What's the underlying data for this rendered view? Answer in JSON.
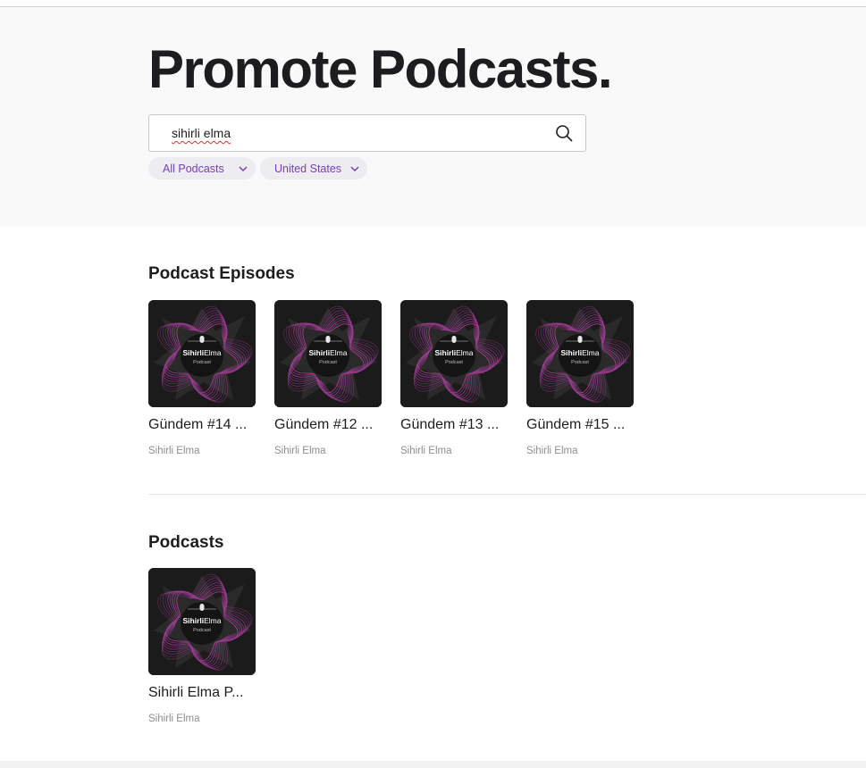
{
  "page": {
    "title": "Promote Podcasts."
  },
  "search": {
    "value": "sihirli elma"
  },
  "filters": [
    {
      "label": "All Podcasts"
    },
    {
      "label": "United States"
    }
  ],
  "episodes_section": {
    "title": "Podcast Episodes",
    "items": [
      {
        "title": "Gündem #14 ...",
        "subtitle": "Sihirli Elma"
      },
      {
        "title": "Gündem #12 ...",
        "subtitle": "Sihirli Elma"
      },
      {
        "title": "Gündem #13 ...",
        "subtitle": "Sihirli Elma"
      },
      {
        "title": "Gündem #15 ...",
        "subtitle": "Sihirli Elma"
      }
    ]
  },
  "podcasts_section": {
    "title": "Podcasts",
    "items": [
      {
        "title": "Sihirli Elma P...",
        "subtitle": "Sihirli Elma"
      }
    ]
  },
  "artwork": {
    "brand_bold": "Sihirli",
    "brand_light": "Elma",
    "caption": "Podcast",
    "colors": {
      "background": "#1b1b1b",
      "wave_pink": "#c2418f",
      "wave_purple": "#7b3a9e"
    }
  },
  "colors": {
    "accent": "#7a3fb0",
    "hero_bg": "#f9f9f9"
  }
}
